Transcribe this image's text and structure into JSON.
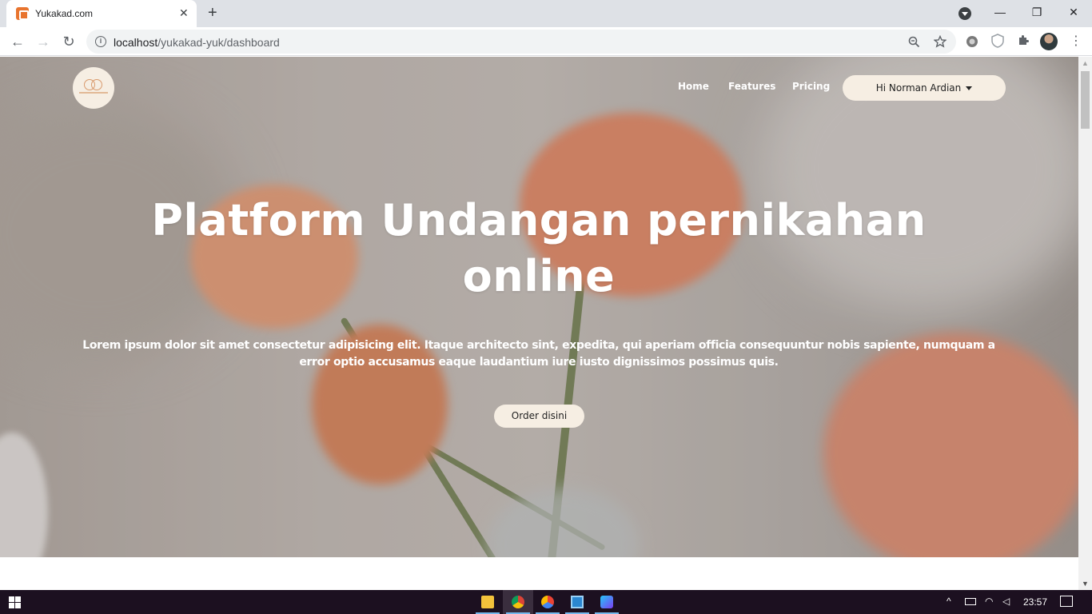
{
  "browser": {
    "tab_title": "Yukakad.com",
    "tab_close_glyph": "✕",
    "new_tab_glyph": "+",
    "url_host": "localhost",
    "url_path": "/yukakad-yuk/dashboard",
    "icons": [
      "back-icon",
      "forward-icon",
      "reload-icon",
      "info-icon",
      "zoom-icon",
      "star-icon",
      "extension-icon",
      "shield-icon",
      "puzzle-icon",
      "profile-avatar",
      "menu-icon"
    ],
    "window_controls": {
      "minimize": "—",
      "restore": "❐",
      "close": "✕"
    }
  },
  "page": {
    "nav": {
      "links": [
        {
          "label": "Home"
        },
        {
          "label": "Features"
        },
        {
          "label": "Pricing"
        }
      ],
      "user_menu_label": "Hi Norman Ardian"
    },
    "hero": {
      "title": "Platform Undangan pernikahan online",
      "description": "Lorem ipsum dolor sit amet consectetur adipisicing elit. Itaque architecto sint, expedita, qui aperiam officia consequuntur nobis sapiente, numquam a error optio accusamus eaque laudantium iure iusto dignissimos possimus quis.",
      "cta_label": "Order disini"
    }
  },
  "taskbar": {
    "apps": [
      "file-explorer-icon",
      "chrome-icon",
      "chrome-canary-icon",
      "remote-desktop-icon",
      "app-icon"
    ],
    "clock": "23:57"
  },
  "colors": {
    "accent_cream": "#f6eee3",
    "logo_peach": "#d99a6c",
    "taskbar": "#1c1020"
  }
}
